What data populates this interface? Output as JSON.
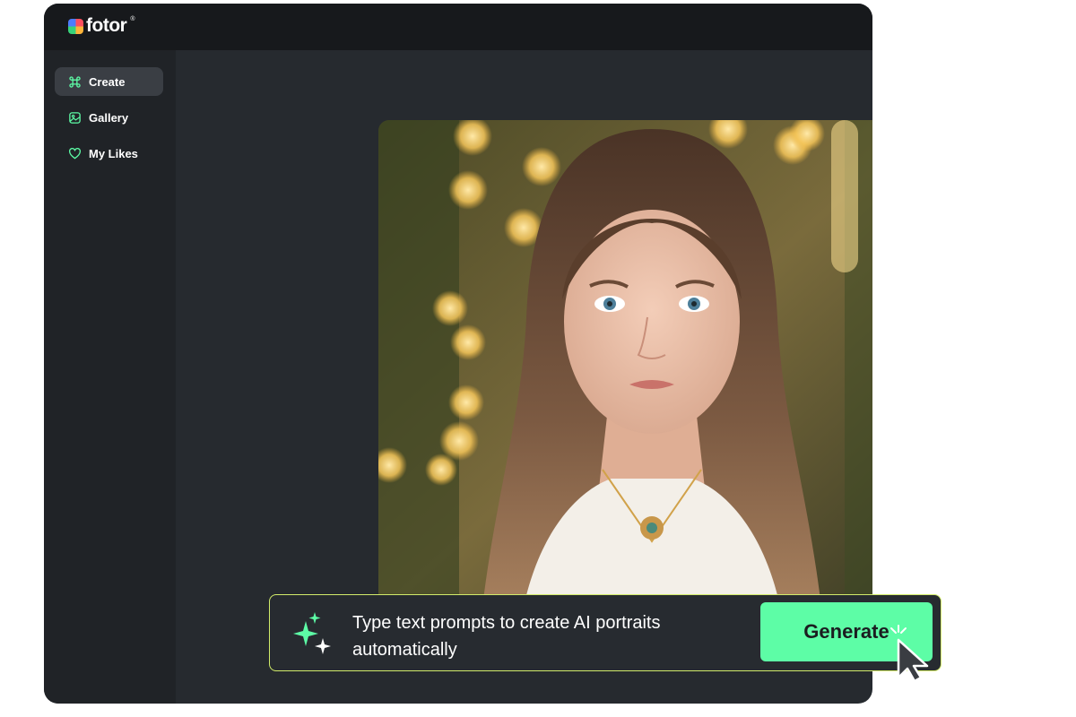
{
  "app": {
    "logo_text": "fotor",
    "logo_mark": "®"
  },
  "sidebar": {
    "items": [
      {
        "label": "Create",
        "icon": "command-icon",
        "active": true
      },
      {
        "label": "Gallery",
        "icon": "gallery-icon",
        "active": false
      },
      {
        "label": "My Likes",
        "icon": "heart-icon",
        "active": false
      }
    ]
  },
  "prompt": {
    "text": "Type text prompts to create AI portraits automatically",
    "generate_label": "Generate",
    "icon": "sparkle-icon"
  },
  "colors": {
    "accent": "#5dfda6",
    "prompt_border": "#d2ec6a",
    "window_bg": "#262a2f",
    "sidebar_bg": "#202327",
    "topbar_bg": "#17191c"
  }
}
